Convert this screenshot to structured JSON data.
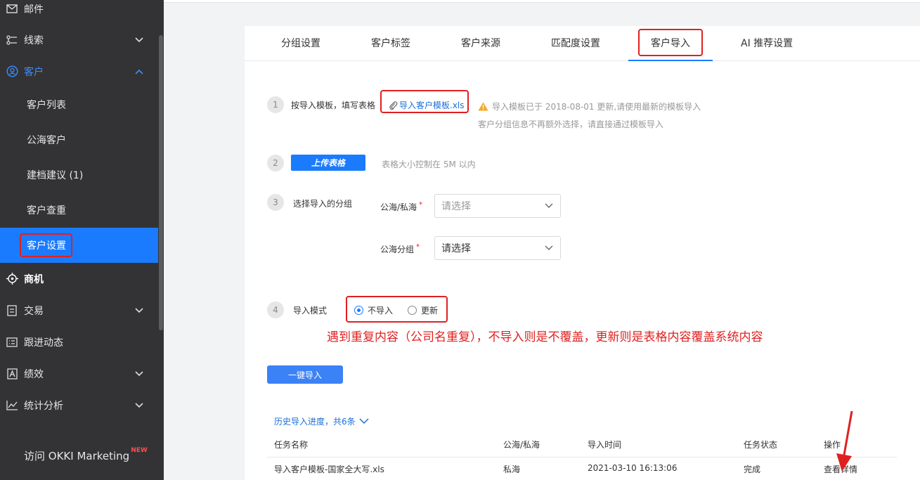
{
  "sidebar": {
    "items": [
      {
        "label": "邮件",
        "icon": "mail-icon"
      },
      {
        "label": "线索",
        "icon": "leads-icon"
      },
      {
        "label": "客户",
        "icon": "customer-icon"
      },
      {
        "label": "客户列表"
      },
      {
        "label": "公海客户"
      },
      {
        "label": "建档建议 (1)"
      },
      {
        "label": "客户查重"
      },
      {
        "label": "客户设置"
      },
      {
        "label": "商机",
        "icon": "opportunity-icon"
      },
      {
        "label": "交易",
        "icon": "trade-icon"
      },
      {
        "label": "跟进动态",
        "icon": "follow-up-icon"
      },
      {
        "label": "绩效",
        "icon": "performance-icon"
      },
      {
        "label": "统计分析",
        "icon": "analytics-icon"
      }
    ],
    "okki_label": "访问 OKKI Marketing",
    "okki_badge": "NEW"
  },
  "tabs": [
    "分组设置",
    "客户标签",
    "客户来源",
    "匹配度设置",
    "客户导入",
    "AI 推荐设置"
  ],
  "active_tab": "客户导入",
  "step1": {
    "num": "1",
    "label": "按导入模板，填写表格",
    "template_link": "导入客户模板.xls",
    "notice_line1": "导入模板已于 2018-08-01 更新,请使用最新的模板导入",
    "notice_line2": "客户分组信息不再额外选择，请直接通过模板导入"
  },
  "step2": {
    "num": "2",
    "button": "上传表格",
    "hint": "表格大小控制在 5M 以内"
  },
  "step3": {
    "num": "3",
    "label": "选择导入的分组",
    "field1_label": "公海/私海",
    "field1_value": "请选择",
    "field2_label": "公海分组",
    "field2_value": "请选择",
    "required_mark": "*"
  },
  "step4": {
    "num": "4",
    "label": "导入模式",
    "option1": "不导入",
    "option2": "更新",
    "selected": "不导入"
  },
  "annotation": "遇到重复内容（公司名重复），不导入则是不覆盖，更新则是表格内容覆盖系统内容",
  "import_button": "一键导入",
  "history": {
    "title": "历史导入进度，共6条",
    "columns": [
      "任务名称",
      "公海/私海",
      "导入时间",
      "任务状态",
      "操作"
    ],
    "rows": [
      {
        "name": "导入客户模板-国家全大写.xls",
        "pool": "私海",
        "time": "2021-03-10 16:13:06",
        "status": "完成",
        "action": "查看详情"
      }
    ]
  },
  "colors": {
    "sidebar_bg": "#333335",
    "accent": "#1a7bff",
    "annotation": "#e02020"
  }
}
